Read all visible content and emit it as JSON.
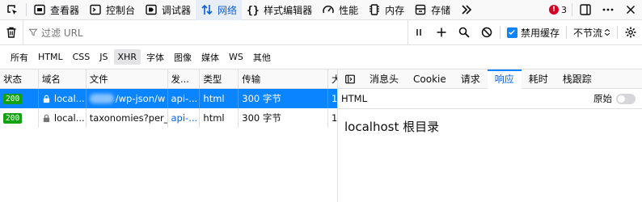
{
  "toolbar": {
    "inspector": "查看器",
    "console": "控制台",
    "debugger": "调试器",
    "network": "网络",
    "style_editor": "样式编辑器",
    "performance": "性能",
    "memory": "内存",
    "storage": "存储",
    "error_count": "3"
  },
  "filterbar": {
    "placeholder": "过滤 URL",
    "disable_cache": "禁用缓存",
    "throttle": "不节流"
  },
  "type_filters": [
    "所有",
    "HTML",
    "CSS",
    "JS",
    "XHR",
    "字体",
    "图像",
    "媒体",
    "WS",
    "其他"
  ],
  "table": {
    "columns": [
      "状态",
      "域名",
      "文件",
      "发...",
      "类型",
      "传输",
      "大"
    ],
    "rows": [
      {
        "status": "200",
        "domain": "local...",
        "file": "/wp-json/w",
        "initiator": "api-...",
        "type": "html",
        "transfer": "300 字节",
        "size": "1"
      },
      {
        "status": "200",
        "domain": "local...",
        "file": "taxonomies?per_p",
        "initiator": "api-...",
        "type": "html",
        "transfer": "300 字节",
        "size": "1"
      }
    ]
  },
  "details": {
    "tabs": [
      "消息头",
      "Cookie",
      "请求",
      "响应",
      "耗时",
      "栈跟踪"
    ],
    "resp_type": "HTML",
    "raw_label": "原始",
    "raw_on": false,
    "body_text": "localhost 根目录"
  },
  "colors": {
    "accent": "#0a84ff",
    "status_ok": "#12a312",
    "error_badge": "#d70022"
  }
}
